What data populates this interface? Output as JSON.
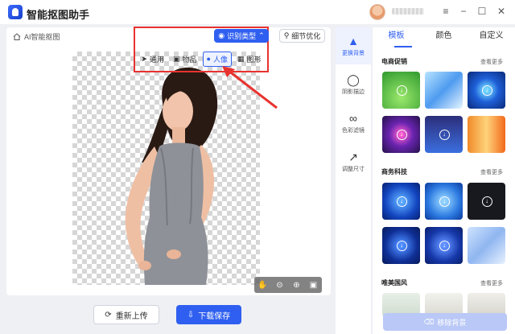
{
  "app": {
    "title": "智能抠图助手",
    "username": ""
  },
  "window_controls": {
    "menu": "≡",
    "minimize": "−",
    "maximize": "☐",
    "close": "✕"
  },
  "breadcrumb": {
    "label": "AI智能抠图"
  },
  "toolbar": {
    "identify_label": "识别类型",
    "detail_label": "细节优化",
    "types": [
      {
        "label": "通用",
        "icon": "send-icon"
      },
      {
        "label": "物品",
        "icon": "box-icon"
      },
      {
        "label": "人像",
        "icon": "person-icon",
        "active": true
      },
      {
        "label": "图形",
        "icon": "shapes-icon"
      }
    ]
  },
  "actions": {
    "reupload": "重新上传",
    "save": "下载保存"
  },
  "tools": [
    {
      "label": "更换背景",
      "icon": "paint-bucket-icon",
      "active": true
    },
    {
      "label": "阴影描边",
      "icon": "shadow-icon"
    },
    {
      "label": "色彩滤镜",
      "icon": "color-filter-icon"
    },
    {
      "label": "调整尺寸",
      "icon": "resize-icon"
    }
  ],
  "panel": {
    "tabs": [
      "模板",
      "颜色",
      "自定义"
    ],
    "active_tab": "模板",
    "sections": [
      {
        "title": "电商促销",
        "more": "查看更多"
      },
      {
        "title": "商务科技",
        "more": "查看更多"
      },
      {
        "title": "唯美国风",
        "more": "查看更多"
      }
    ],
    "remove_bg": "移除背景"
  },
  "colors": {
    "accent": "#2f5ff0",
    "highlight": "#e8332f"
  }
}
